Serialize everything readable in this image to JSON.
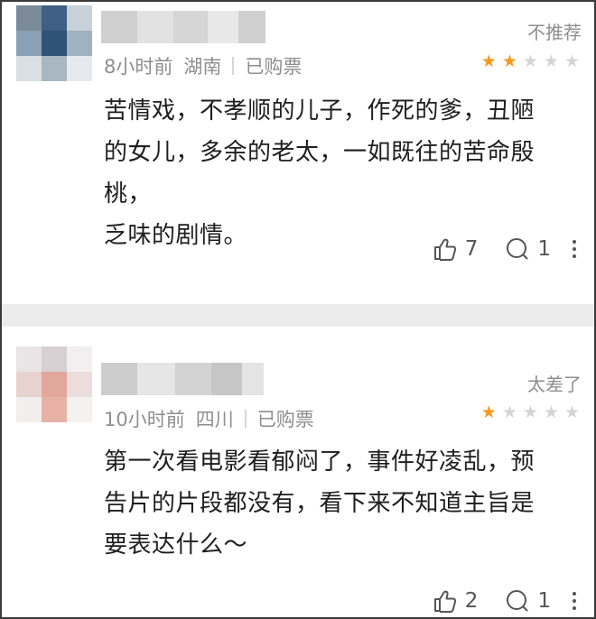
{
  "comments": [
    {
      "time": "8小时前",
      "location": "湖南",
      "ticket": "已购票",
      "verdict": "不推荐",
      "rating": 2,
      "text_lines": [
        "苦情戏，不孝顺的儿子，作死的爹，丑陋",
        "的女儿，多余的老太，一如既往的苦命殷桃，",
        "乏味的剧情。"
      ],
      "likes": "7",
      "replies": "1"
    },
    {
      "time": "10小时前",
      "location": "四川",
      "ticket": "已购票",
      "verdict": "太差了",
      "rating": 1,
      "text_lines": [
        "第一次看电影看郁闷了，事件好凌乱，预",
        "告片的片段都没有，看下来不知道主旨是",
        "要表达什么～"
      ],
      "likes": "2",
      "replies": "1"
    }
  ],
  "colors": {
    "star_active": "#f39a1d",
    "star_inactive": "#d4d4d4",
    "meta_text": "#8e8e8e",
    "body_text": "#1e1e1e",
    "divider": "#ececec"
  }
}
